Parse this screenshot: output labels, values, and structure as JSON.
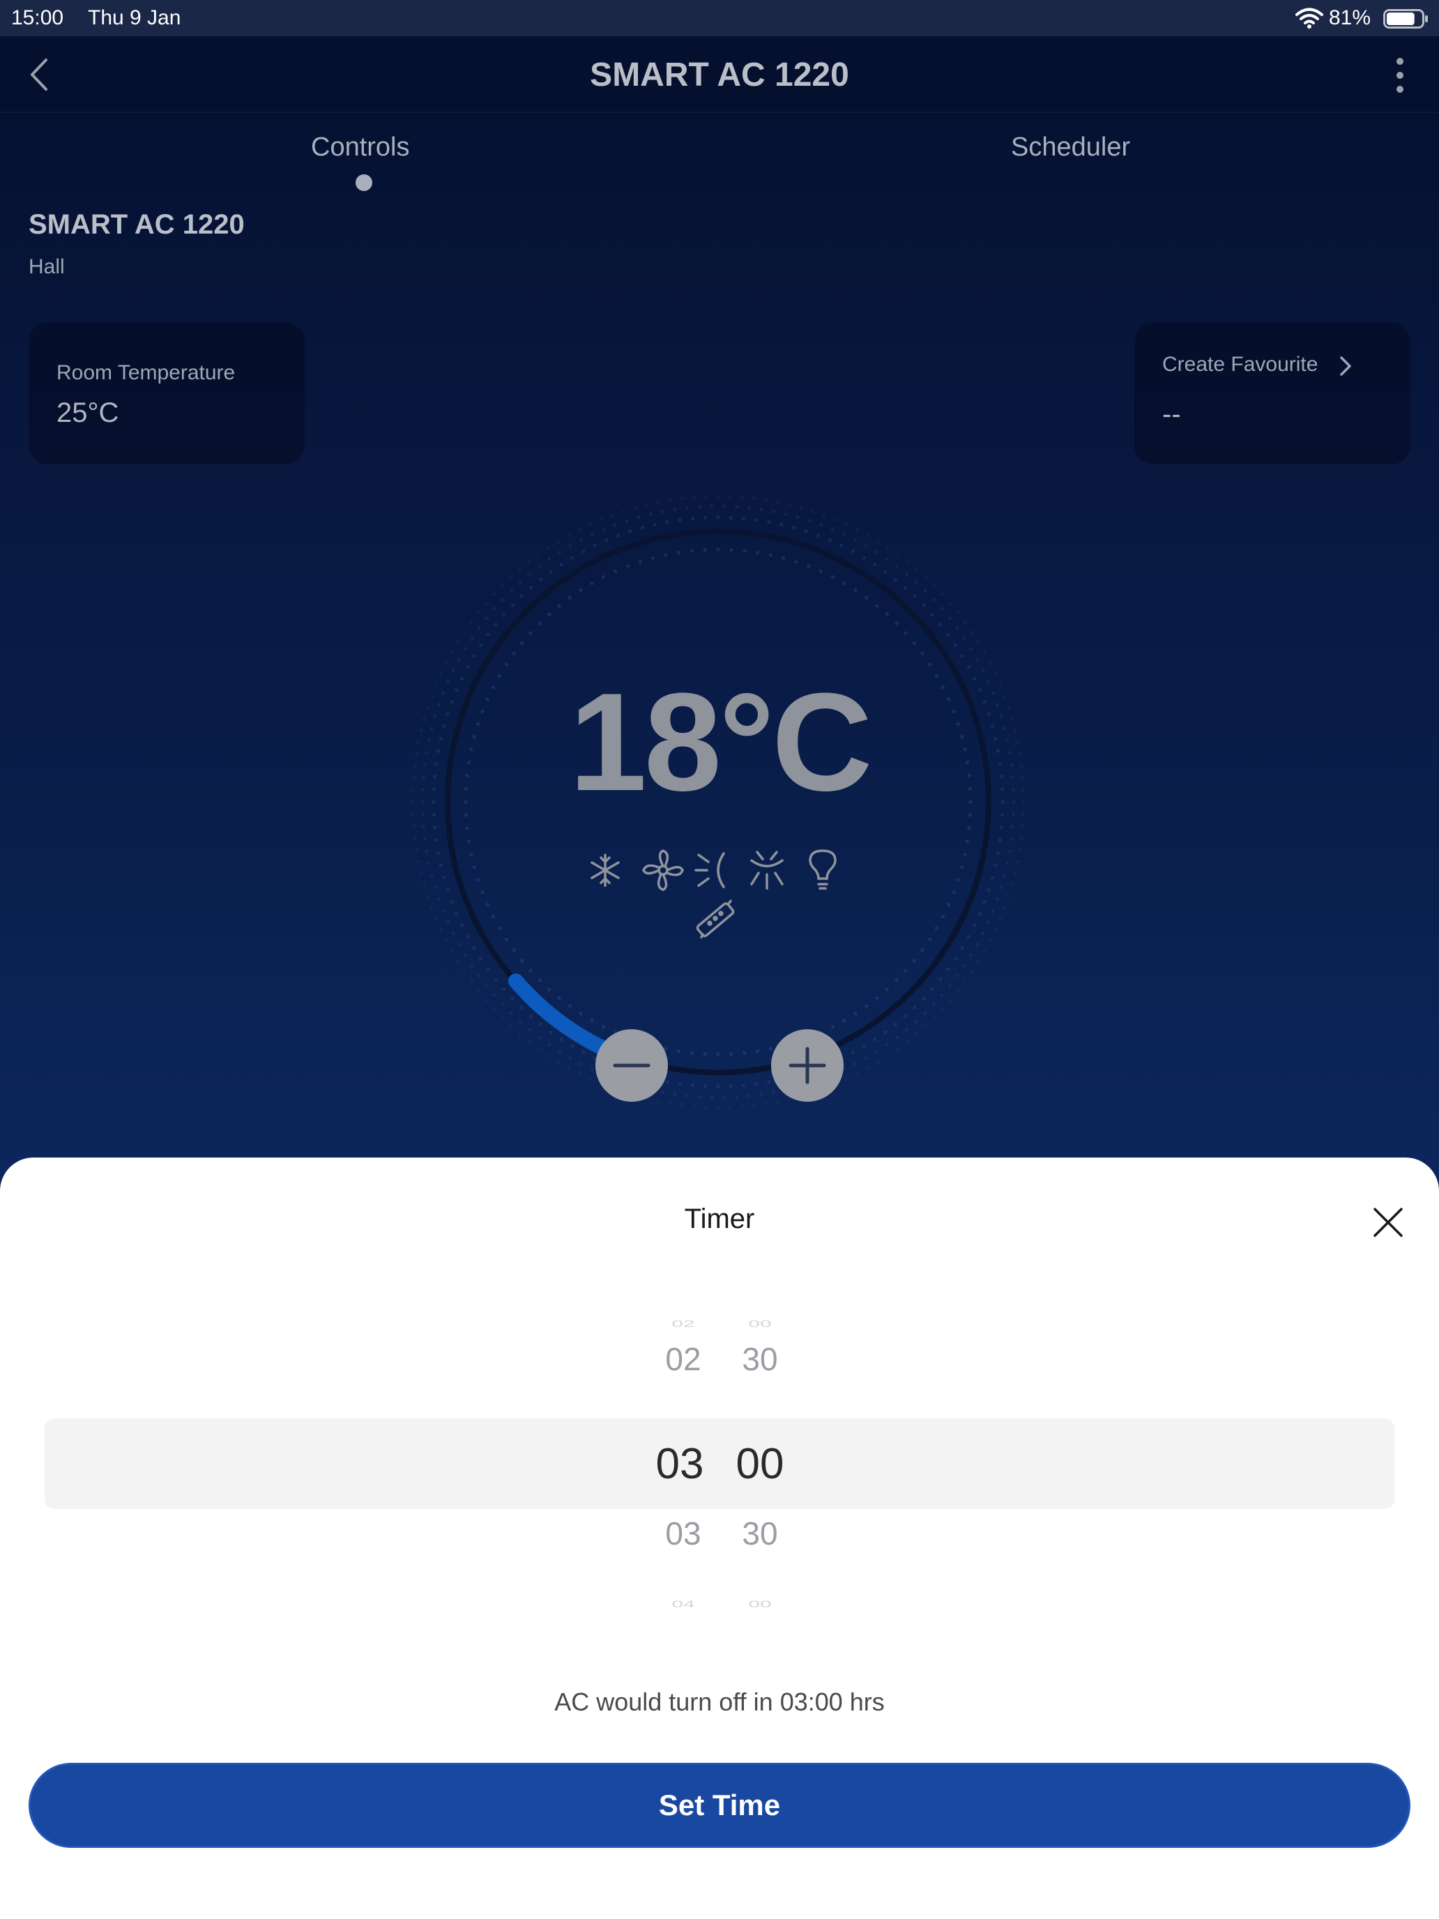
{
  "status_bar": {
    "time": "15:00",
    "date": "Thu 9 Jan",
    "battery": "81%",
    "battery_level": 0.81
  },
  "nav": {
    "title": "SMART AC 1220"
  },
  "tabs": [
    {
      "label": "Controls",
      "active": true
    },
    {
      "label": "Scheduler",
      "active": false
    }
  ],
  "device": {
    "name": "SMART AC 1220",
    "room": "Hall"
  },
  "room_temp_card": {
    "label": "Room Temperature",
    "value": "25°C"
  },
  "favourite_card": {
    "label": "Create Favourite",
    "value": "--"
  },
  "thermostat": {
    "set_temp": "18°C",
    "mode_icons": [
      "snowflake-icon",
      "fan-icon",
      "swing-horizontal-icon",
      "swing-vertical-icon",
      "bulb-icon",
      "filter-icon"
    ]
  },
  "timer_sheet": {
    "title": "Timer",
    "picker_rows": [
      {
        "hours": "02",
        "minutes": "00"
      },
      {
        "hours": "02",
        "minutes": "30"
      },
      {
        "hours": "03",
        "minutes": "00"
      },
      {
        "hours": "03",
        "minutes": "30"
      },
      {
        "hours": "04",
        "minutes": "00"
      }
    ],
    "selected_index": 2,
    "message": "AC would turn off in 03:00 hrs",
    "button_label": "Set Time"
  },
  "colors": {
    "primary_button": "#1848a0",
    "dial_arc": "#0d5bbf"
  }
}
